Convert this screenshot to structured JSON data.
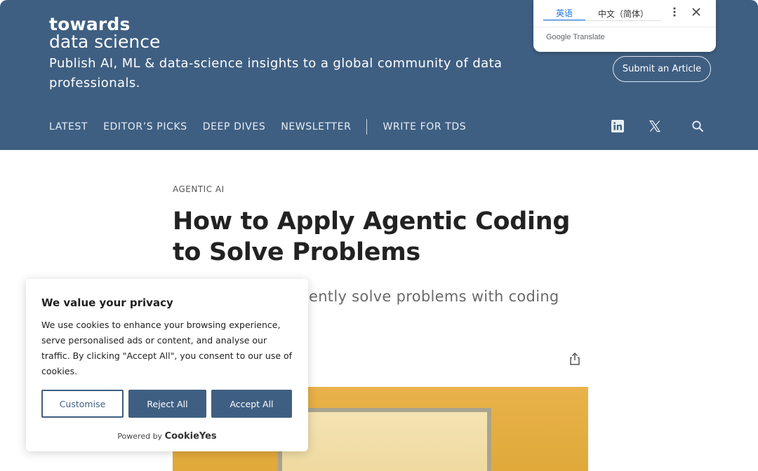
{
  "header": {
    "logo_top": "towards",
    "logo_bottom": "data science",
    "tagline": "Publish AI, ML & data-science insights to a global community of data professionals.",
    "submit_label": "Submit an Article",
    "nav": [
      "LATEST",
      "EDITOR’S PICKS",
      "DEEP DIVES",
      "NEWSLETTER",
      "WRITE FOR TDS"
    ],
    "icons": [
      "linkedin-icon",
      "x-icon",
      "search-icon"
    ],
    "bg_color": "#3f5f82"
  },
  "translate": {
    "tab_source": "英语",
    "tab_target": "中文（简体）",
    "brand": "Google Translate"
  },
  "article": {
    "kicker": "AGENTIC AI",
    "title": "How to Apply Agentic Coding to Solve Problems",
    "subtitle_visible": "ciently solve problems with coding"
  },
  "cookie": {
    "title": "We value your privacy",
    "text": "We use cookies to enhance your browsing experience, serve personalised ads or content, and analyse our traffic. By clicking \"Accept All\", you consent to our use of cookies.",
    "customise": "Customise",
    "reject": "Reject All",
    "accept": "Accept All",
    "powered_by": "Powered by",
    "powered_brand": "CookieYes"
  }
}
